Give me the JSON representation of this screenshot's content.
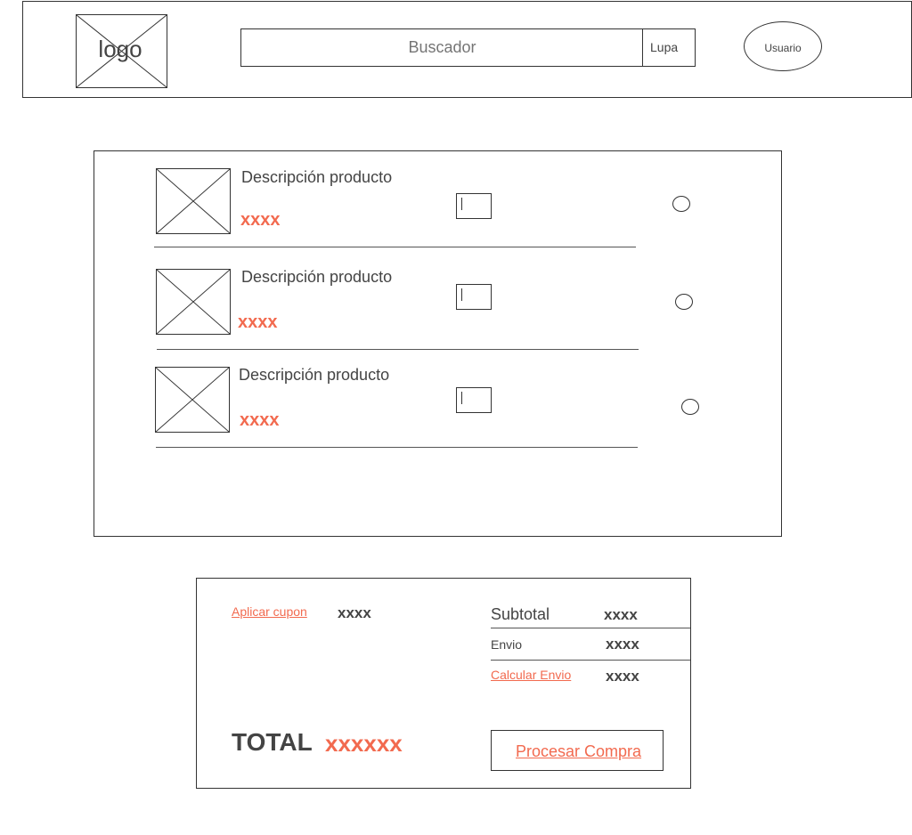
{
  "header": {
    "logo_label": "logo",
    "search_placeholder": "Buscador",
    "search_button": "Lupa",
    "user_button": "Usuario"
  },
  "cart": {
    "items": [
      {
        "description": "Descripción producto",
        "price": "xxxx"
      },
      {
        "description": "Descripción producto",
        "price": "xxxx"
      },
      {
        "description": "Descripción producto",
        "price": "xxxx"
      }
    ]
  },
  "summary": {
    "coupon_link": "Aplicar cupon",
    "coupon_value": "xxxx",
    "subtotal_label": "Subtotal",
    "subtotal_value": "xxxx",
    "shipping_label": "Envio",
    "shipping_value": "xxxx",
    "calc_shipping_link": "Calcular Envio",
    "calc_shipping_value": "xxxx",
    "total_label": "TOTAL",
    "total_value": "xxxxxx",
    "checkout_button": "Procesar Compra"
  },
  "colors": {
    "accent": "#f26a4f",
    "text": "#444444",
    "border": "#333333"
  }
}
